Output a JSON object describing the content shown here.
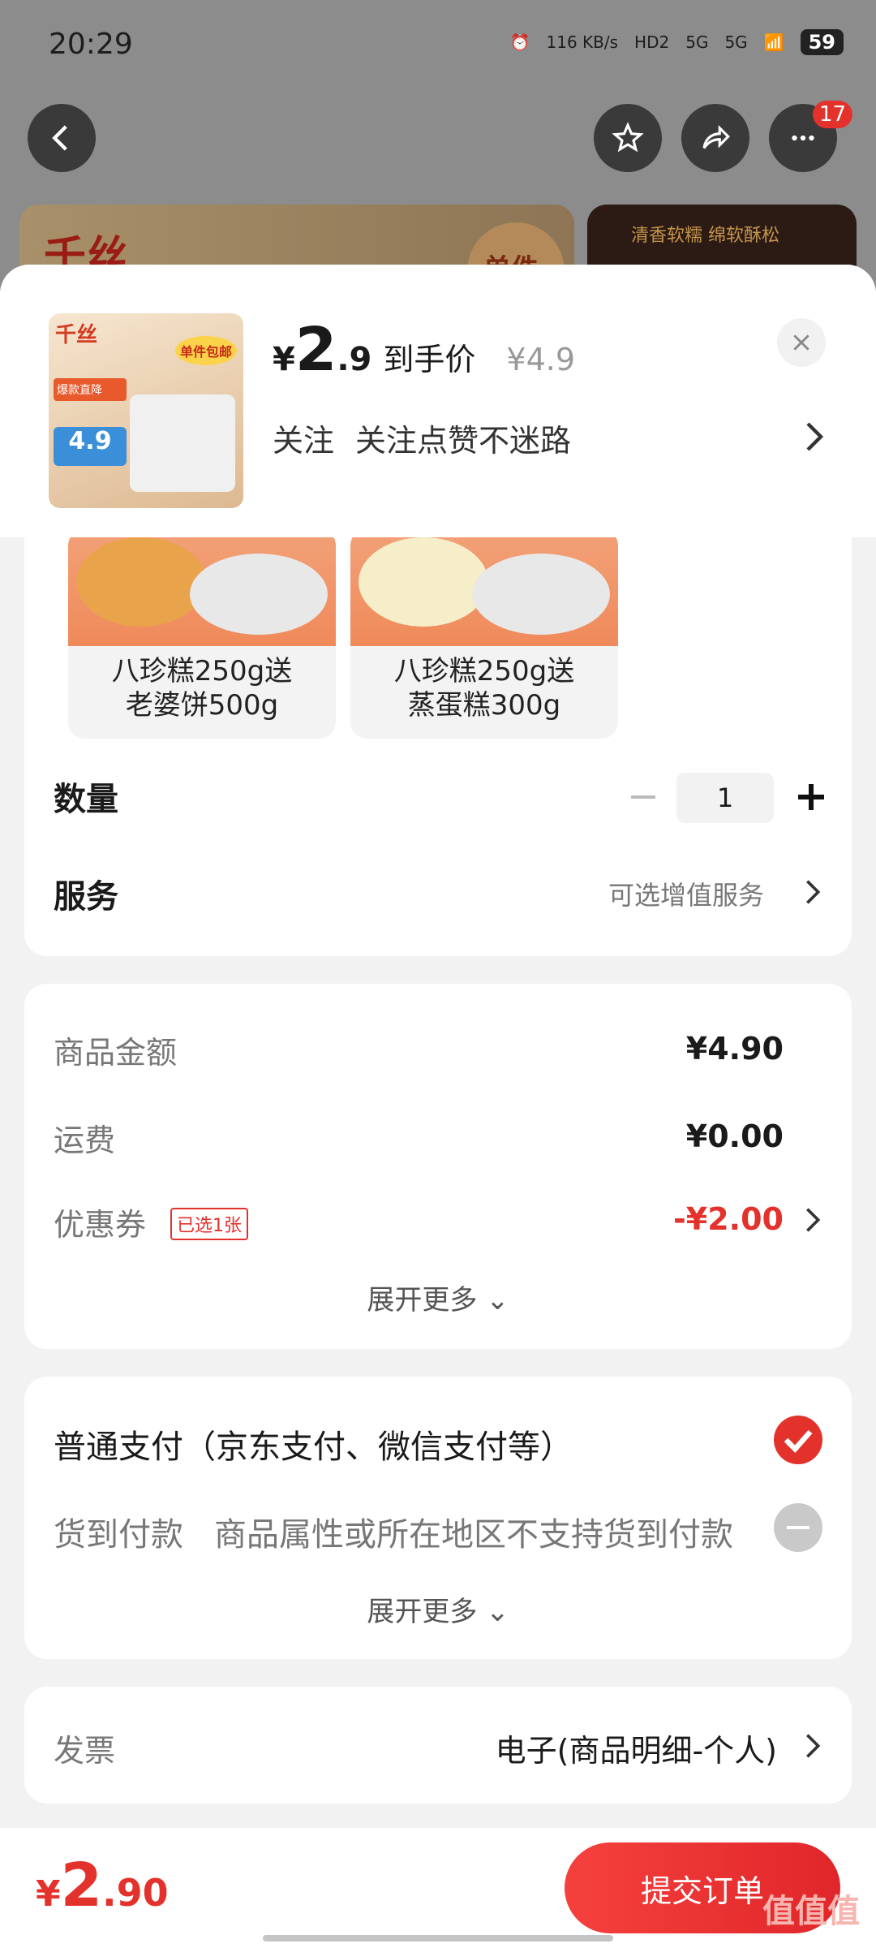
{
  "status_bar": {
    "time": "20:29",
    "net_speed": "116 KB/s",
    "hd": "HD2",
    "sig1": "5G",
    "sig2": "5G",
    "battery": "59"
  },
  "nav": {
    "notification_count": "17"
  },
  "background_banner": {
    "brand": "千丝",
    "tag": "单件",
    "right_text": "清香软糯 绵软酥松"
  },
  "product": {
    "thumb_brand": "千丝",
    "thumb_badge": "单件包邮",
    "thumb_promo": "爆款直降",
    "thumb_price": "4.9",
    "price_currency": "¥",
    "price_int": "2",
    "price_dec": ".9",
    "price_label": "到手价",
    "original_price": "¥4.9",
    "follow_label": "关注",
    "follow_text": "关注点赞不迷路"
  },
  "variants": [
    {
      "label_line1": "八珍糕250g送",
      "label_line2": "老婆饼500g"
    },
    {
      "label_line1": "八珍糕250g送",
      "label_line2": "蒸蛋糕300g"
    }
  ],
  "quantity": {
    "label": "数量",
    "value": "1"
  },
  "service": {
    "label": "服务",
    "value": "可选增值服务"
  },
  "summary": {
    "goods_label": "商品金额",
    "goods_value": "¥4.90",
    "shipping_label": "运费",
    "shipping_value": "¥0.00",
    "coupon_label": "优惠券",
    "coupon_tag": "已选1张",
    "coupon_value": "-¥2.00",
    "expand_label": "展开更多"
  },
  "payment": {
    "normal_label": "普通支付（京东支付、微信支付等）",
    "cod_label": "货到付款",
    "cod_note": "商品属性或所在地区不支持货到付款",
    "expand_label": "展开更多"
  },
  "invoice": {
    "label": "发票",
    "value": "电子(商品明细-个人)"
  },
  "footer": {
    "currency": "¥",
    "total_int": "2",
    "total_dec": ".90",
    "submit_label": "提交订单",
    "watermark": "值值值"
  },
  "colors": {
    "accent": "#e3322c"
  }
}
